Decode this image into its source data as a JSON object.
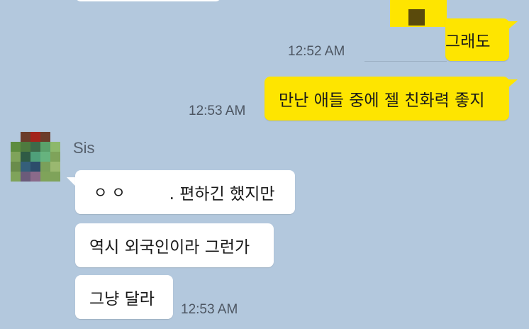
{
  "messages": {
    "m1": {
      "text": "그래도",
      "time": "12:52 AM"
    },
    "m2": {
      "text": "만난 애들 중에 젤 친화력 좋지",
      "time": "12:53 AM"
    },
    "sender": {
      "name": "Sis"
    },
    "m3": {
      "prefix": "ㅇㅇ",
      "text": ". 편하긴 했지만"
    },
    "m4": {
      "text": "역시 외국인이라 그런가"
    },
    "m5": {
      "text": "그냥 달라",
      "time": "12:53 AM"
    }
  },
  "colors": {
    "background": "#b3c8dd",
    "my_bubble": "#fee500",
    "other_bubble": "#ffffff",
    "timestamp": "#4d5662"
  },
  "icons": {
    "avatar": "pixelated-profile-avatar",
    "sticker": "pixelated-image-thumbnail"
  }
}
